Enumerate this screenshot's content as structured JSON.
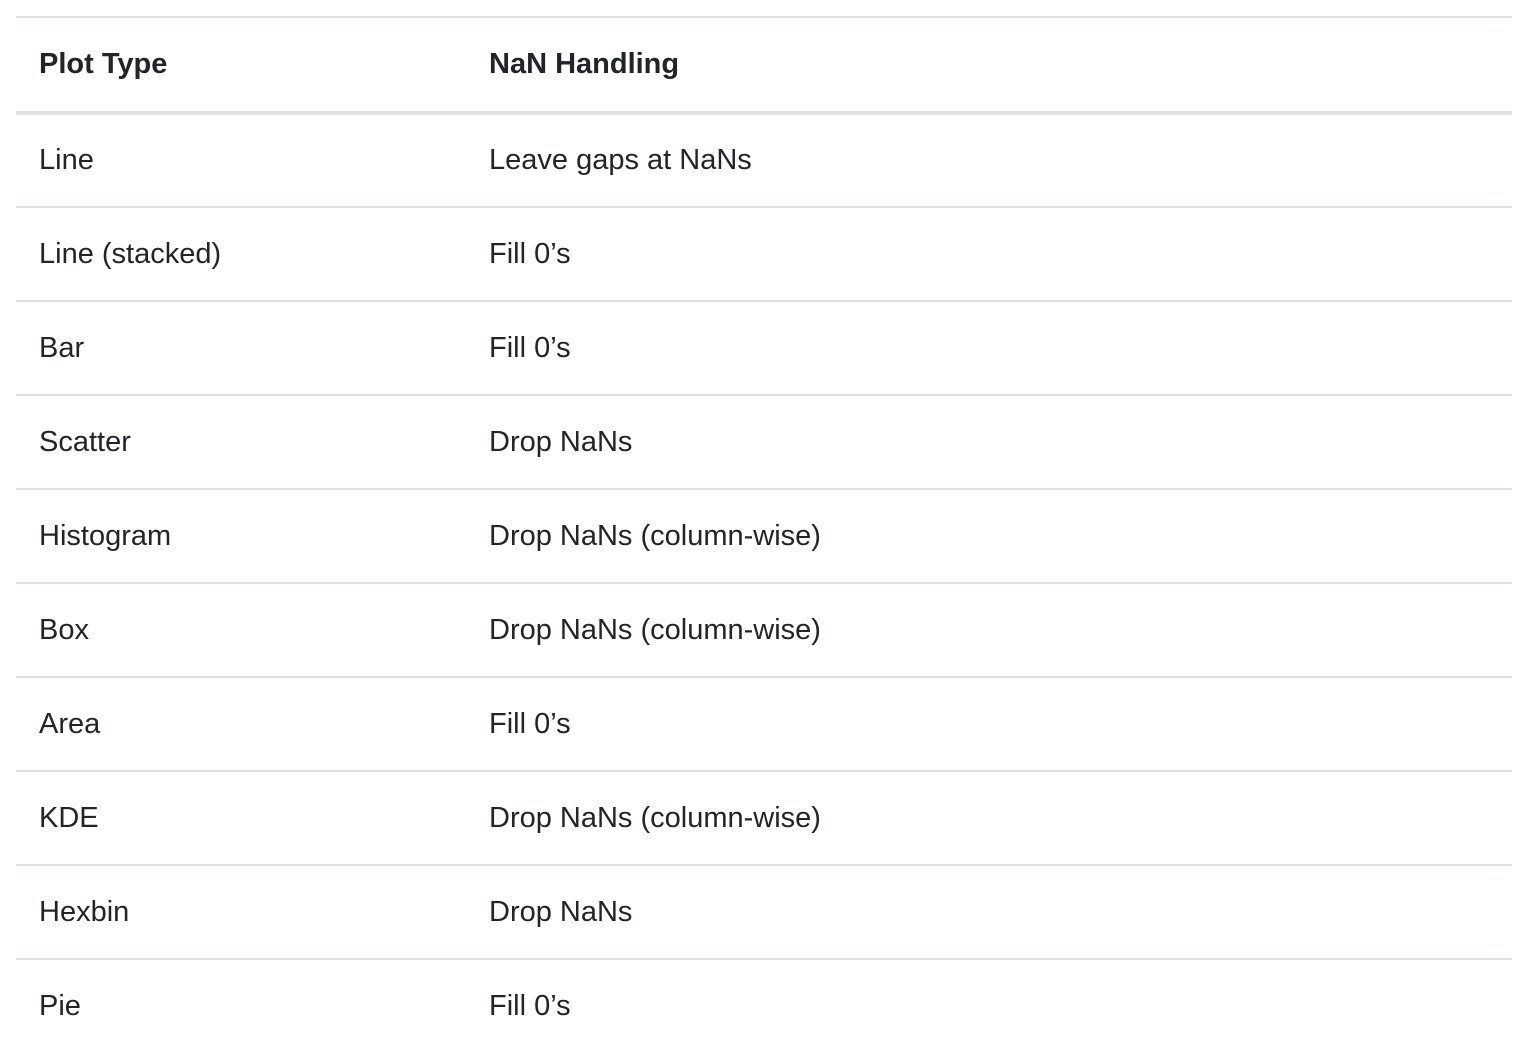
{
  "table": {
    "headers": [
      "Plot Type",
      "NaN Handling"
    ],
    "rows": [
      [
        "Line",
        "Leave gaps at NaNs"
      ],
      [
        "Line (stacked)",
        "Fill 0’s"
      ],
      [
        "Bar",
        "Fill 0’s"
      ],
      [
        "Scatter",
        "Drop NaNs"
      ],
      [
        "Histogram",
        "Drop NaNs (column-wise)"
      ],
      [
        "Box",
        "Drop NaNs (column-wise)"
      ],
      [
        "Area",
        "Fill 0’s"
      ],
      [
        "KDE",
        "Drop NaNs (column-wise)"
      ],
      [
        "Hexbin",
        "Drop NaNs"
      ],
      [
        "Pie",
        "Fill 0’s"
      ]
    ]
  }
}
